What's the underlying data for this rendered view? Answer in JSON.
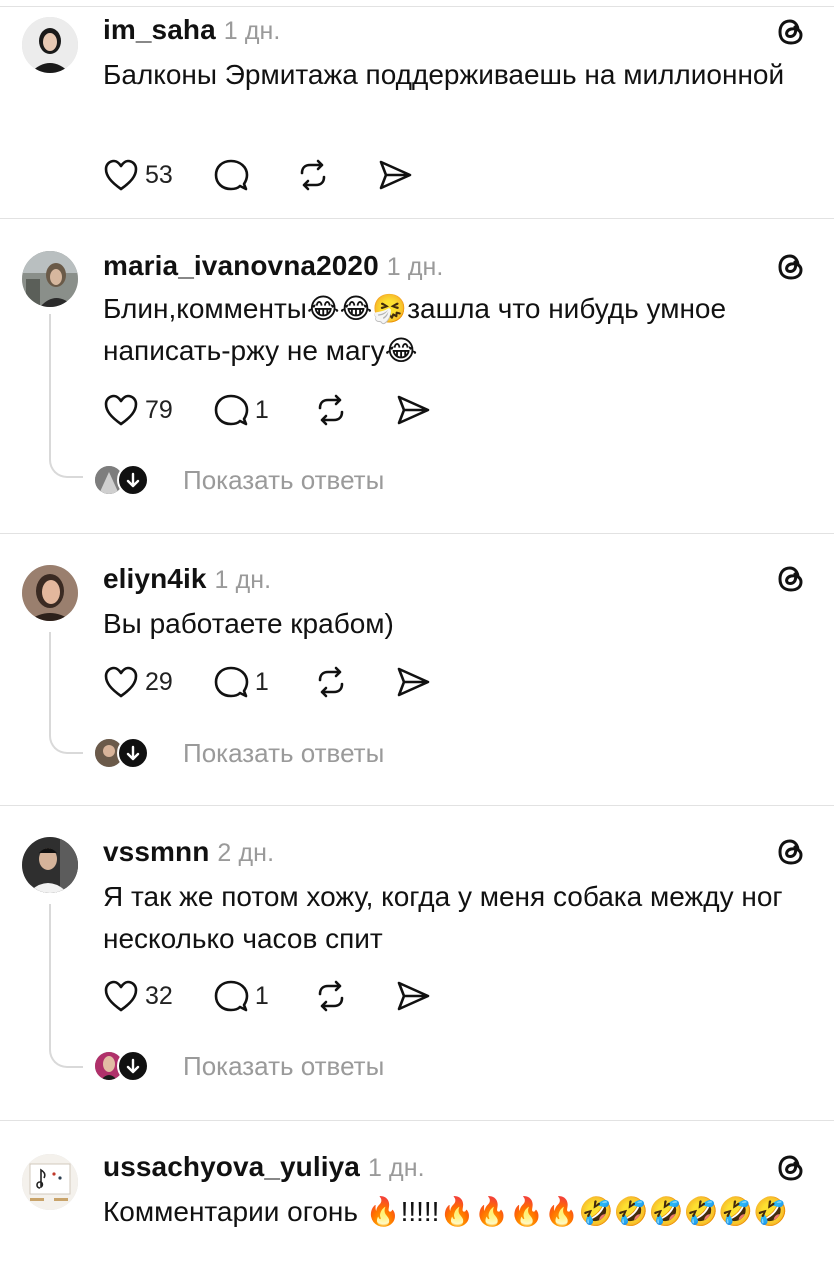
{
  "posts": [
    {
      "username": "im_saha",
      "time": "1 дн.",
      "text": "Балконы Эрмитажа поддерживаешь  на миллионной",
      "likes": "53",
      "replies_count": "",
      "show_replies": ""
    },
    {
      "username": "maria_ivanovna2020",
      "time": "1 дн.",
      "text": "Блин,комменты😂😂🤧зашла что нибудь умное написать-ржу не магу😂",
      "likes": "79",
      "replies_count": "1",
      "show_replies": "Показать ответы"
    },
    {
      "username": "eliyn4ik",
      "time": "1 дн.",
      "text": "Вы работаете крабом)",
      "likes": "29",
      "replies_count": "1",
      "show_replies": "Показать ответы"
    },
    {
      "username": "vssmnn",
      "time": "2 дн.",
      "text": "Я так же потом хожу, когда у меня собака между ног несколько часов спит",
      "likes": "32",
      "replies_count": "1",
      "show_replies": "Показать ответы"
    },
    {
      "username": "ussachyova_yuliya",
      "time": "1 дн.",
      "text": "Комментарии огонь 🔥!!!!!🔥🔥🔥🔥🤣🤣🤣🤣🤣🤣",
      "likes": "",
      "replies_count": "",
      "show_replies": ""
    }
  ],
  "icons": {
    "like": "heart-icon",
    "reply": "comment-icon",
    "repost": "repost-icon",
    "share": "send-icon",
    "brand": "threads-icon",
    "expand": "arrow-down-icon"
  }
}
